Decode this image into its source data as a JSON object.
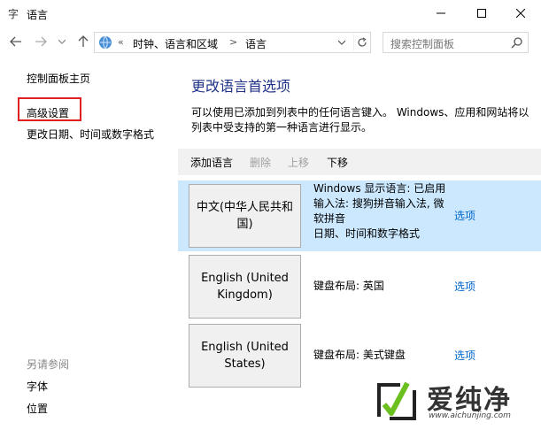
{
  "window": {
    "title": "语言",
    "icon": "language-icon"
  },
  "nav": {
    "breadcrumb_parent": "时钟、语言和区域",
    "breadcrumb_current": "语言",
    "breadcrumb_overflow": "«",
    "breadcrumb_separator": ">",
    "search_placeholder": "搜索控制面板"
  },
  "left_panel": {
    "home": "控制面板主页",
    "advanced": "高级设置",
    "date_time": "更改日期、时间或数字格式",
    "see_also_title": "另请参阅",
    "see_also_items": [
      "字体",
      "位置"
    ],
    "highlight_color": "#e02020"
  },
  "main": {
    "heading": "更改语言首选项",
    "description": "可以使用已添加到列表中的任何语言键入。 Windows、应用和网站将以列表中受支持的第一种语言进行显示。",
    "toolbar": {
      "add": "添加语言",
      "remove": "删除",
      "move_up": "上移",
      "move_down": "下移"
    },
    "languages": [
      {
        "name": "中文(中华人民共和国)",
        "info": [
          "Windows 显示语言: 已启用",
          "输入法: 搜狗拼音输入法, 微软拼音",
          "日期、时间和数字格式"
        ],
        "option": "选项",
        "selected": true
      },
      {
        "name": "English (United Kingdom)",
        "info": [
          "键盘布局: 英国"
        ],
        "option": "选项",
        "selected": false
      },
      {
        "name": "English (United States)",
        "info": [
          "键盘布局: 美式键盘"
        ],
        "option": "选项",
        "selected": false
      }
    ]
  },
  "colors": {
    "heading": "#1e3287",
    "link": "#0066cc",
    "selected_row": "#cce8ff",
    "toolbar_bg": "#f1f1f1"
  },
  "watermark": {
    "text": "爱纯净",
    "url": "www.aichunjing.com"
  }
}
